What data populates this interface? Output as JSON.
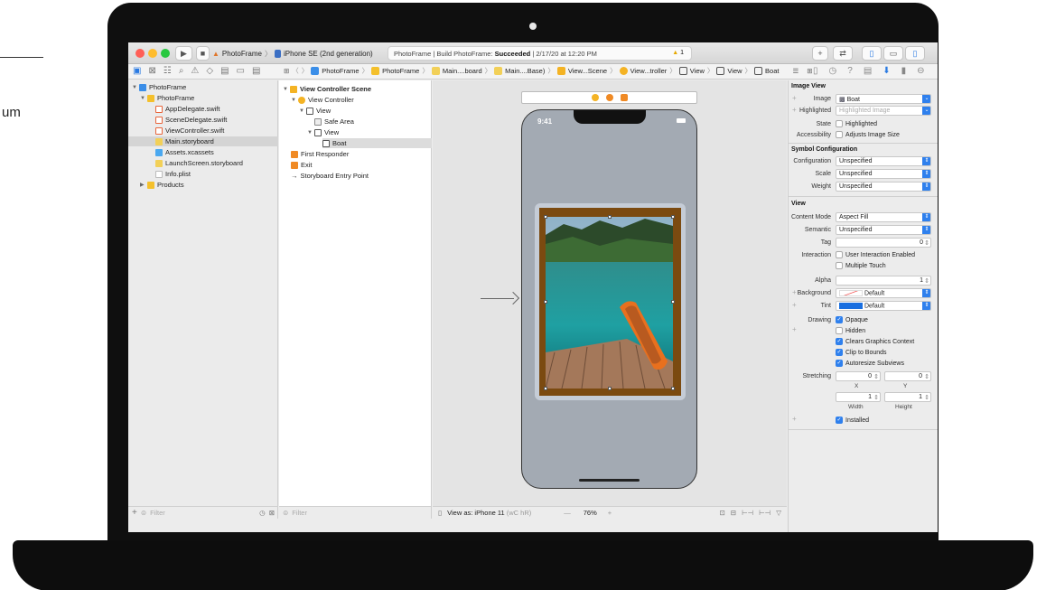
{
  "background": {
    "partial_text": "um"
  },
  "toolbar": {
    "scheme_target": "PhotoFrame",
    "scheme_device": "iPhone SE (2nd generation)",
    "status": {
      "project": "PhotoFrame",
      "build_prefix": "Build PhotoFrame:",
      "build_result": "Succeeded",
      "timestamp": "2/17/20 at 12:20 PM"
    },
    "warning_count": "1"
  },
  "jump_bar": [
    "PhotoFrame",
    "PhotoFrame",
    "Main....board",
    "Main....Base)",
    "View...Scene",
    "View...troller",
    "View",
    "View",
    "Boat"
  ],
  "navigator": {
    "items": [
      {
        "label": "PhotoFrame",
        "icon": "project-icon"
      },
      {
        "label": "PhotoFrame",
        "icon": "folder-icon"
      },
      {
        "label": "AppDelegate.swift",
        "icon": "swift-file-icon"
      },
      {
        "label": "SceneDelegate.swift",
        "icon": "swift-file-icon"
      },
      {
        "label": "ViewController.swift",
        "icon": "swift-file-icon"
      },
      {
        "label": "Main.storyboard",
        "icon": "storyboard-icon"
      },
      {
        "label": "Assets.xcassets",
        "icon": "assets-icon"
      },
      {
        "label": "LaunchScreen.storyboard",
        "icon": "storyboard-icon"
      },
      {
        "label": "Info.plist",
        "icon": "plist-icon"
      },
      {
        "label": "Products",
        "icon": "folder-icon"
      }
    ],
    "filter_placeholder": "Filter"
  },
  "outline": {
    "items": [
      {
        "label": "View Controller Scene"
      },
      {
        "label": "View Controller"
      },
      {
        "label": "View"
      },
      {
        "label": "Safe Area"
      },
      {
        "label": "View"
      },
      {
        "label": "Boat"
      },
      {
        "label": "First Responder"
      },
      {
        "label": "Exit"
      },
      {
        "label": "Storyboard Entry Point"
      }
    ],
    "filter_placeholder": "Filter"
  },
  "canvas": {
    "phone_time": "9:41",
    "view_as": "View as: iPhone 11",
    "view_as_suffix": "(wC hR)",
    "zoom": "76%",
    "zoom_minus": "—",
    "zoom_plus": "+"
  },
  "inspector": {
    "image_view": {
      "heading": "Image View",
      "image_label": "Image",
      "image_value": "Boat",
      "highlighted_label": "Highlighted",
      "highlighted_placeholder": "Highlighted Image",
      "state_label": "State",
      "state_option": "Highlighted",
      "accessibility_label": "Accessibility",
      "accessibility_option": "Adjusts Image Size"
    },
    "symbol": {
      "heading": "Symbol Configuration",
      "configuration_label": "Configuration",
      "configuration_value": "Unspecified",
      "scale_label": "Scale",
      "scale_value": "Unspecified",
      "weight_label": "Weight",
      "weight_value": "Unspecified"
    },
    "view": {
      "heading": "View",
      "content_mode_label": "Content Mode",
      "content_mode_value": "Aspect Fill",
      "semantic_label": "Semantic",
      "semantic_value": "Unspecified",
      "tag_label": "Tag",
      "tag_value": "0",
      "interaction_label": "Interaction",
      "interaction_option1": "User Interaction Enabled",
      "interaction_option2": "Multiple Touch",
      "alpha_label": "Alpha",
      "alpha_value": "1",
      "background_label": "Background",
      "background_value": "Default",
      "tint_label": "Tint",
      "tint_value": "Default",
      "drawing_label": "Drawing",
      "drawing_options": [
        "Opaque",
        "Hidden",
        "Clears Graphics Context",
        "Clip to Bounds",
        "Autoresize Subviews"
      ],
      "stretching_label": "Stretching",
      "stretch_x": "0",
      "stretch_y": "0",
      "stretch_width": "1",
      "stretch_height": "1",
      "x_label": "X",
      "y_label": "Y",
      "width_label": "Width",
      "height_label": "Height",
      "installed_label": "Installed"
    }
  },
  "colors": {
    "accent": "#2f80ed",
    "tint_swatch": "#1a6fe0",
    "frame_wood": "#7b4a10",
    "phone_bg": "#a3aab3"
  }
}
